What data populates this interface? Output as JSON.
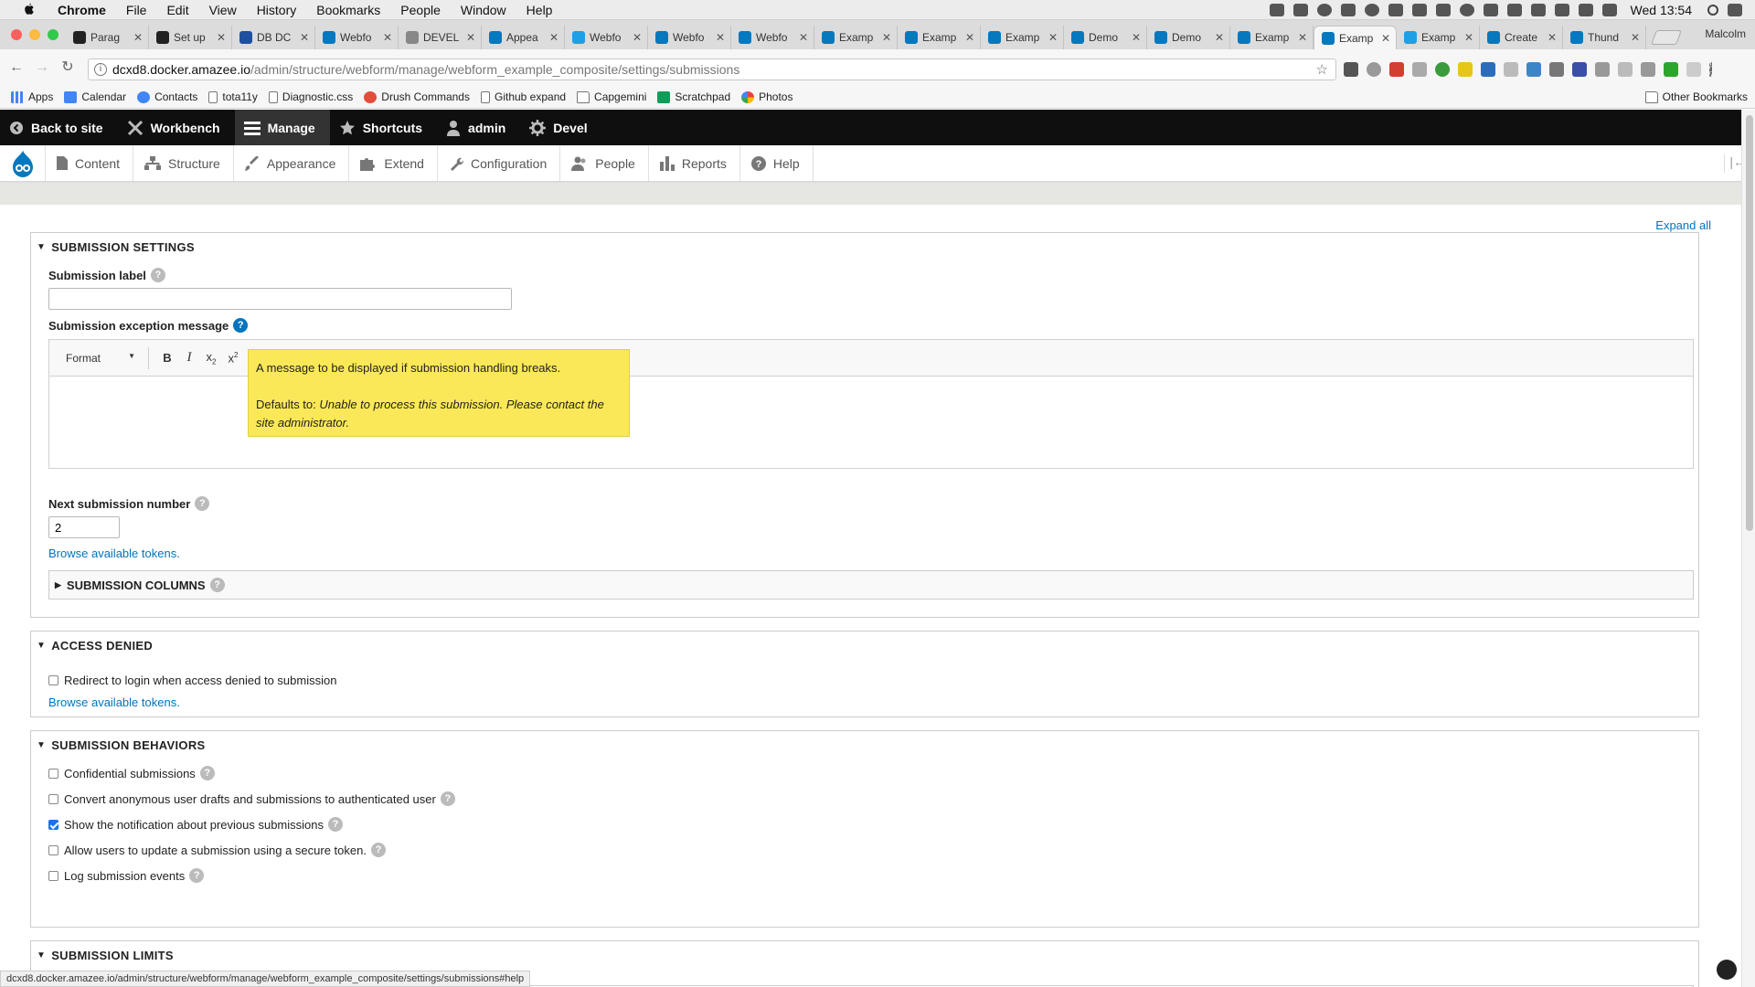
{
  "menubar": {
    "app": "Chrome",
    "items": [
      "File",
      "Edit",
      "View",
      "History",
      "Bookmarks",
      "People",
      "Window",
      "Help"
    ],
    "clock": "Wed 13:54"
  },
  "tabs": [
    {
      "label": "Parag",
      "color": "#222"
    },
    {
      "label": "Set up",
      "color": "#222"
    },
    {
      "label": "DB DC",
      "color": "#1e50a0"
    },
    {
      "label": "Webfo",
      "color": "#0678be"
    },
    {
      "label": "DEVEL",
      "color": "#888"
    },
    {
      "label": "Appea",
      "color": "#0678be"
    },
    {
      "label": "Webfo",
      "color": "#1ea0e6"
    },
    {
      "label": "Webfo",
      "color": "#0678be"
    },
    {
      "label": "Webfo",
      "color": "#0678be"
    },
    {
      "label": "Examp",
      "color": "#0678be"
    },
    {
      "label": "Examp",
      "color": "#0678be"
    },
    {
      "label": "Examp",
      "color": "#0678be"
    },
    {
      "label": "Demo",
      "color": "#0678be"
    },
    {
      "label": "Demo",
      "color": "#0678be"
    },
    {
      "label": "Examp",
      "color": "#0678be"
    },
    {
      "label": "Examp",
      "color": "#0678be",
      "active": true
    },
    {
      "label": "Examp",
      "color": "#1ea0e6"
    },
    {
      "label": "Create",
      "color": "#0678be"
    },
    {
      "label": "Thund",
      "color": "#0678be"
    }
  ],
  "profile": "Malcolm",
  "url": {
    "domain": "dcxd8.docker.amazee.io",
    "path": "/admin/structure/webform/manage/webform_example_composite/settings/submissions"
  },
  "bookmarks": [
    {
      "label": "Apps",
      "icon": "apps-grid"
    },
    {
      "label": "Calendar",
      "icon": "calendar"
    },
    {
      "label": "Contacts",
      "icon": "contacts"
    },
    {
      "label": "tota11y",
      "icon": "page"
    },
    {
      "label": "Diagnostic.css",
      "icon": "page"
    },
    {
      "label": "Drush Commands",
      "icon": "drush"
    },
    {
      "label": "Github expand",
      "icon": "page"
    },
    {
      "label": "Capgemini",
      "icon": "folder"
    },
    {
      "label": "Scratchpad",
      "icon": "sheet"
    },
    {
      "label": "Photos",
      "icon": "photos"
    }
  ],
  "other_bookmarks": "Other Bookmarks",
  "toolbar": {
    "back": "Back to site",
    "workbench": "Workbench",
    "manage": "Manage",
    "shortcuts": "Shortcuts",
    "user": "admin",
    "devel": "Devel"
  },
  "admin_menu": [
    "Content",
    "Structure",
    "Appearance",
    "Extend",
    "Configuration",
    "People",
    "Reports",
    "Help"
  ],
  "expand_all": "Expand all",
  "submission_settings": {
    "legend": "SUBMISSION SETTINGS",
    "label_field": "Submission label",
    "label_value": "",
    "exception_label": "Submission exception message",
    "format_select": "Format",
    "tooltip_line1": "A message to be displayed if submission handling breaks.",
    "tooltip_prefix": "Defaults to: ",
    "tooltip_default": "Unable to process this submission. Please contact the site administrator.",
    "next_number_label": "Next submission number",
    "next_number_value": "2",
    "browse_tokens": "Browse available tokens.",
    "columns_legend": "SUBMISSION COLUMNS"
  },
  "access_denied": {
    "legend": "ACCESS DENIED",
    "redirect_label": "Redirect to login when access denied to submission",
    "redirect_checked": false,
    "browse_tokens": "Browse available tokens."
  },
  "behaviors": {
    "legend": "SUBMISSION BEHAVIORS",
    "items": [
      {
        "label": "Confidential submissions",
        "checked": false,
        "help": true
      },
      {
        "label": "Convert anonymous user drafts and submissions to authenticated user",
        "checked": false,
        "help": true
      },
      {
        "label": "Show the notification about previous submissions",
        "checked": true,
        "help": true
      },
      {
        "label": "Allow users to update a submission using a secure token.",
        "checked": false,
        "help": true
      },
      {
        "label": "Log submission events",
        "checked": false,
        "help": true
      }
    ]
  },
  "limits": {
    "legend": "SUBMISSION LIMITS"
  },
  "status_url": "dcxd8.docker.amazee.io/admin/structure/webform/manage/webform_example_composite/settings/submissions#help"
}
